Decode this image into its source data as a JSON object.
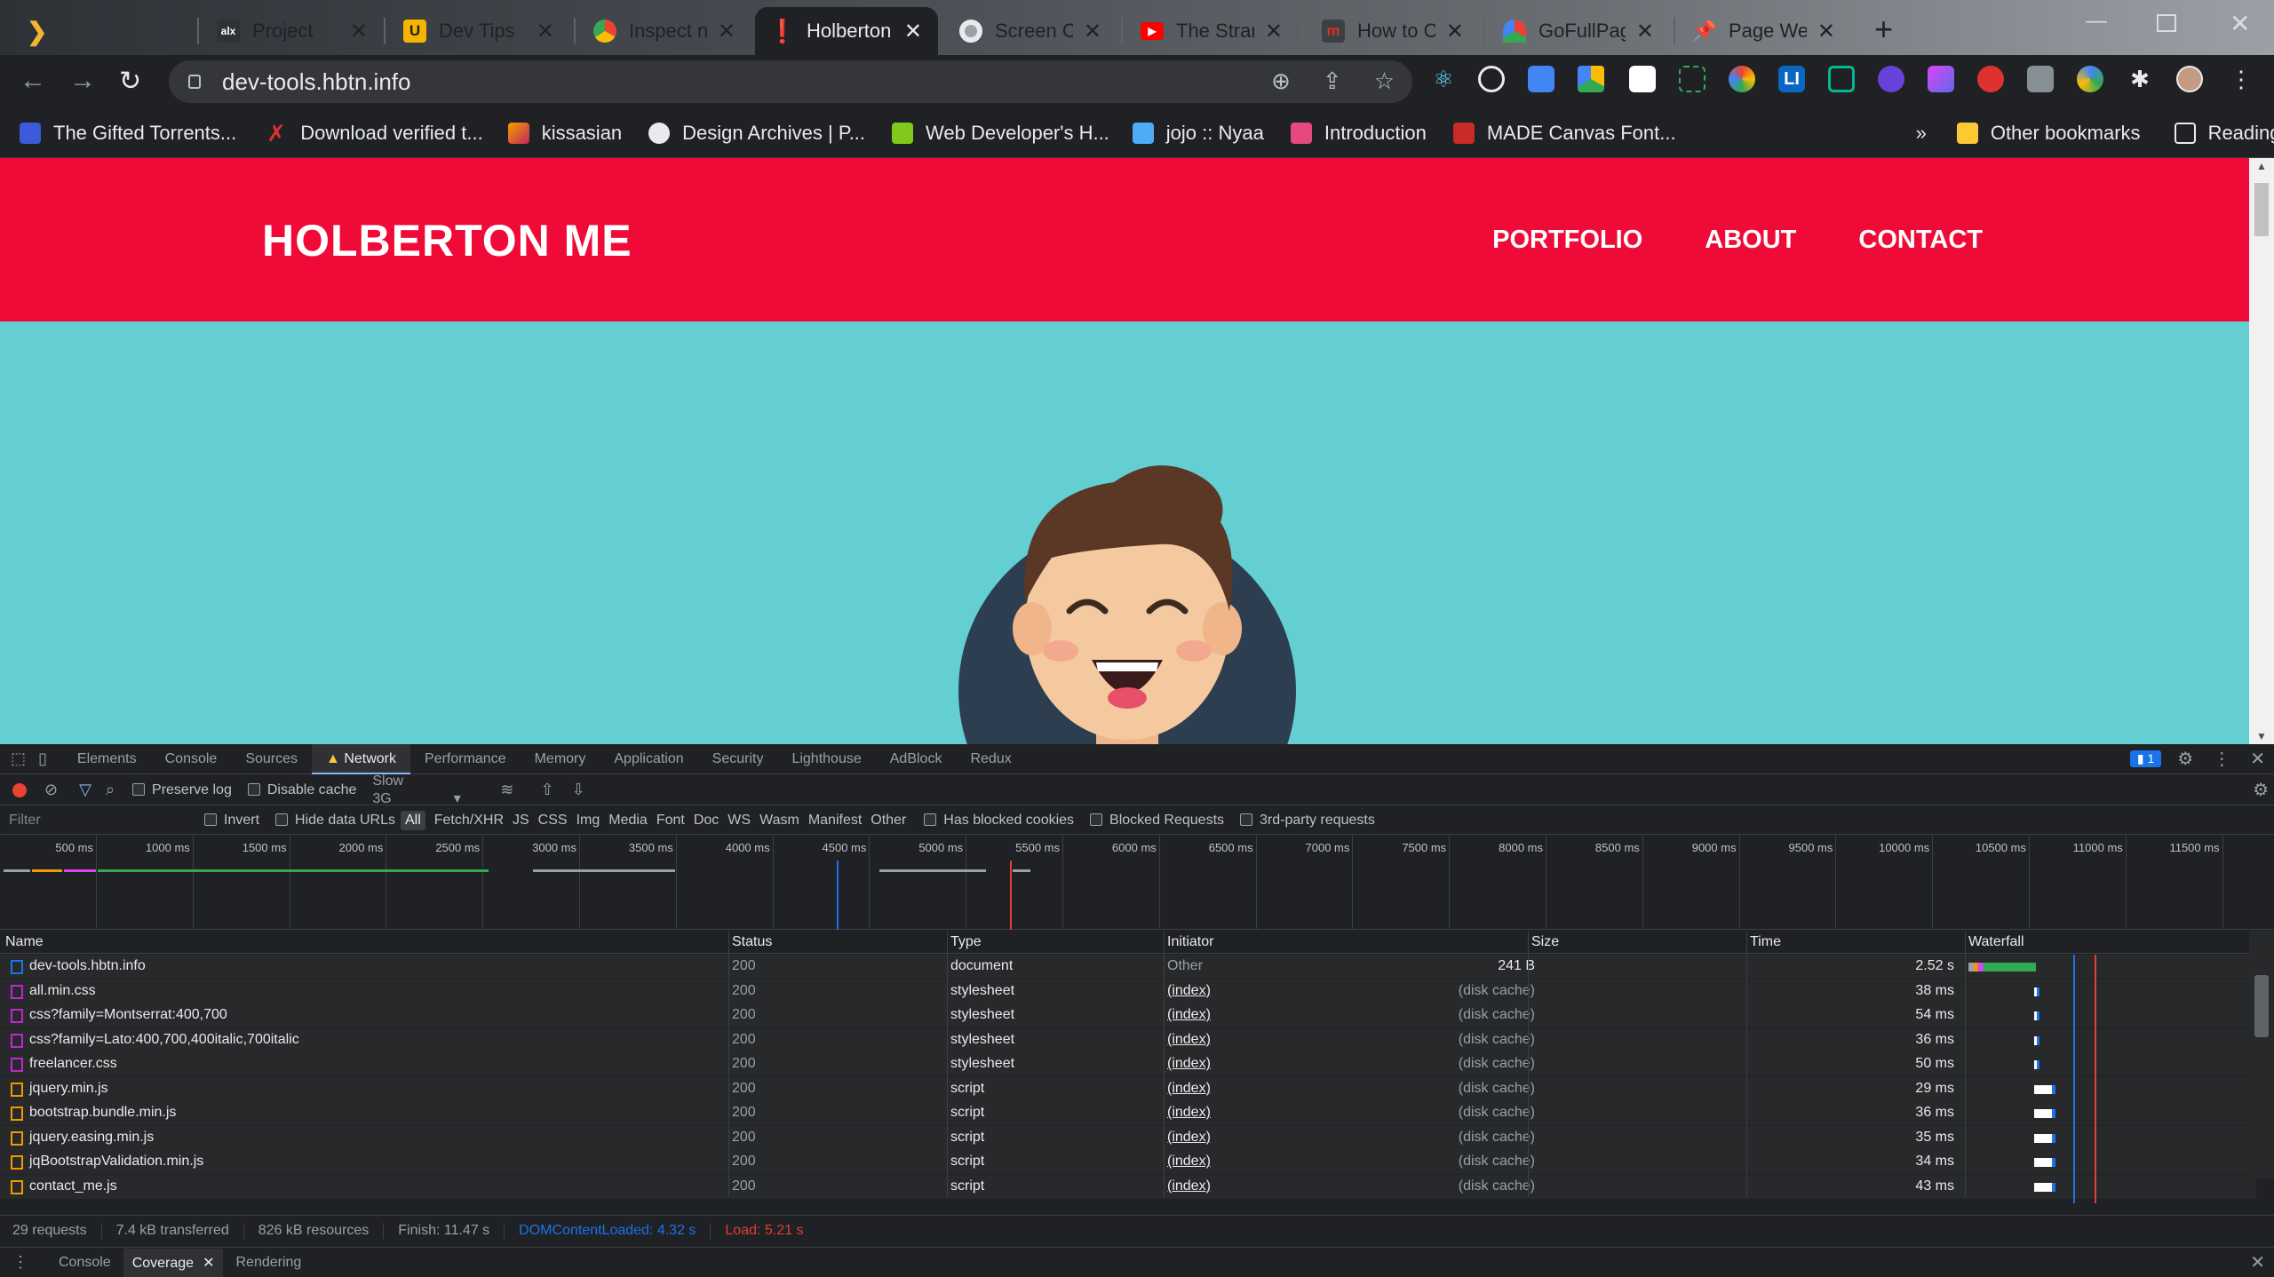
{
  "browser": {
    "tabs": [
      {
        "title": "Project",
        "icon": "alx-icon",
        "color": "#2e3136"
      },
      {
        "title": "Dev Tips",
        "icon": "u-icon",
        "color": "#f4b400"
      },
      {
        "title": "Inspect ne",
        "icon": "chrome-icon",
        "color": "#4285f4"
      },
      {
        "title": "Holberton",
        "icon": "holberton-icon",
        "color": "#e8003c"
      },
      {
        "title": "Screen Ca",
        "icon": "record-icon",
        "color": "#9aa0a6"
      },
      {
        "title": "The Stran",
        "icon": "youtube-icon",
        "color": "#ff0000"
      },
      {
        "title": "How to Ca",
        "icon": "m-icon",
        "color": "#d93025"
      },
      {
        "title": "GoFullPag",
        "icon": "gofullpage-icon",
        "color": "#34a853"
      },
      {
        "title": "Page Weig",
        "icon": "pin-icon",
        "color": "#f29900"
      }
    ],
    "url": "dev-tools.hbtn.info",
    "bookmarks": [
      {
        "label": "The Gifted Torrents...",
        "color": "#3b5bdb"
      },
      {
        "label": "Download verified t...",
        "color": "#e03131"
      },
      {
        "label": "kissasian",
        "color": "#c2255c"
      },
      {
        "label": "Design Archives | P...",
        "color": "#e8eaed"
      },
      {
        "label": "Web Developer's H...",
        "color": "#82c91e"
      },
      {
        "label": "jojo :: Nyaa",
        "color": "#4dabf7"
      },
      {
        "label": "Introduction",
        "color": "#e64980"
      },
      {
        "label": "MADE Canvas Font...",
        "color": "#c92a2a"
      }
    ],
    "other_bookmarks": "Other bookmarks",
    "reading_list": "Reading list",
    "overflow": "»"
  },
  "site": {
    "brand": "HOLBERTON ME",
    "nav": [
      "PORTFOLIO",
      "ABOUT",
      "CONTACT"
    ]
  },
  "devtools": {
    "tabs": [
      "Elements",
      "Console",
      "Sources",
      "Network",
      "Performance",
      "Memory",
      "Application",
      "Security",
      "Lighthouse",
      "AdBlock",
      "Redux"
    ],
    "active_tab": "Network",
    "issues_count": "1",
    "preserve_log": "Preserve log",
    "disable_cache": "Disable cache",
    "throttle": "Slow 3G",
    "filter_placeholder": "Filter",
    "invert": "Invert",
    "hide_data_urls": "Hide data URLs",
    "filter_types": [
      "All",
      "Fetch/XHR",
      "JS",
      "CSS",
      "Img",
      "Media",
      "Font",
      "Doc",
      "WS",
      "Wasm",
      "Manifest",
      "Other"
    ],
    "has_blocked_cookies": "Has blocked cookies",
    "blocked_requests": "Blocked Requests",
    "third_party": "3rd-party requests",
    "timeline_ticks": [
      "500 ms",
      "1000 ms",
      "1500 ms",
      "2000 ms",
      "2500 ms",
      "3000 ms",
      "3500 ms",
      "4000 ms",
      "4500 ms",
      "5000 ms",
      "5500 ms",
      "6000 ms",
      "6500 ms",
      "7000 ms",
      "7500 ms",
      "8000 ms",
      "8500 ms",
      "9000 ms",
      "9500 ms",
      "10000 ms",
      "10500 ms",
      "11000 ms",
      "11500 ms"
    ],
    "columns": [
      "Name",
      "Status",
      "Type",
      "Initiator",
      "Size",
      "Time",
      "Waterfall"
    ],
    "requests": [
      {
        "name": "dev-tools.hbtn.info",
        "status": "200",
        "type": "document",
        "initiator": "Other",
        "size": "241 B",
        "time": "2.52 s",
        "kind": "doc"
      },
      {
        "name": "all.min.css",
        "status": "200",
        "type": "stylesheet",
        "initiator": "(index)",
        "size": "(disk cache)",
        "time": "38 ms",
        "kind": "css"
      },
      {
        "name": "css?family=Montserrat:400,700",
        "status": "200",
        "type": "stylesheet",
        "initiator": "(index)",
        "size": "(disk cache)",
        "time": "54 ms",
        "kind": "css"
      },
      {
        "name": "css?family=Lato:400,700,400italic,700italic",
        "status": "200",
        "type": "stylesheet",
        "initiator": "(index)",
        "size": "(disk cache)",
        "time": "36 ms",
        "kind": "css"
      },
      {
        "name": "freelancer.css",
        "status": "200",
        "type": "stylesheet",
        "initiator": "(index)",
        "size": "(disk cache)",
        "time": "50 ms",
        "kind": "css"
      },
      {
        "name": "jquery.min.js",
        "status": "200",
        "type": "script",
        "initiator": "(index)",
        "size": "(disk cache)",
        "time": "29 ms",
        "kind": "js"
      },
      {
        "name": "bootstrap.bundle.min.js",
        "status": "200",
        "type": "script",
        "initiator": "(index)",
        "size": "(disk cache)",
        "time": "36 ms",
        "kind": "js"
      },
      {
        "name": "jquery.easing.min.js",
        "status": "200",
        "type": "script",
        "initiator": "(index)",
        "size": "(disk cache)",
        "time": "35 ms",
        "kind": "js"
      },
      {
        "name": "jqBootstrapValidation.min.js",
        "status": "200",
        "type": "script",
        "initiator": "(index)",
        "size": "(disk cache)",
        "time": "34 ms",
        "kind": "js"
      },
      {
        "name": "contact_me.js",
        "status": "200",
        "type": "script",
        "initiator": "(index)",
        "size": "(disk cache)",
        "time": "43 ms",
        "kind": "js"
      }
    ],
    "summary": {
      "requests": "29 requests",
      "transferred": "7.4 kB transferred",
      "resources": "826 kB resources",
      "finish": "Finish: 11.47 s",
      "dom_loaded": "DOMContentLoaded: 4.32 s",
      "load": "Load: 5.21 s"
    },
    "drawer_tabs": [
      "Console",
      "Coverage",
      "Rendering"
    ],
    "drawer_active": "Coverage"
  },
  "colors": {
    "brand_red": "#ef0a38",
    "teal": "#64cfd3",
    "dom_blue": "#1a73e8",
    "load_red": "#e33e2e"
  }
}
